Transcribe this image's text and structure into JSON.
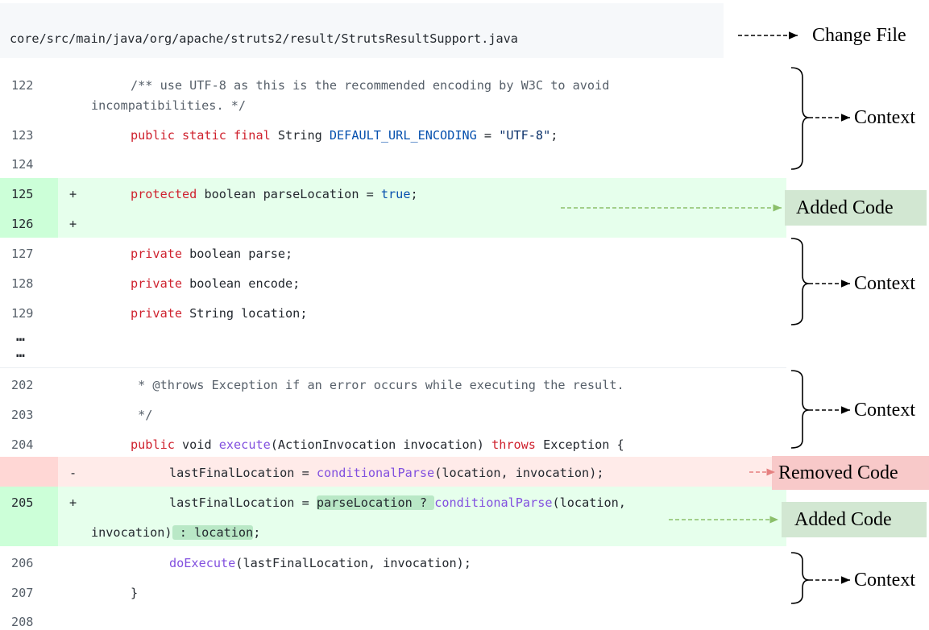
{
  "file": {
    "path": "core/src/main/java/org/apache/struts2/result/StrutsResultSupport.java"
  },
  "annotations": {
    "change_file": "Change File",
    "context": "Context",
    "added_code": "Added Code",
    "removed_code": "Removed Code"
  },
  "ellipsis": "…",
  "lines": {
    "l122": {
      "num": "122",
      "code1": "/** use UTF-8 as this is the recommended encoding by W3C to avoid",
      "code2": "incompatibilities. */"
    },
    "l123": {
      "num": "123",
      "kw": "public static final",
      "t1": " String ",
      "const": "DEFAULT_URL_ENCODING",
      "t2": " = ",
      "str": "\"UTF-8\"",
      "t3": ";"
    },
    "l124": {
      "num": "124"
    },
    "l125": {
      "num": "125",
      "sign": "+",
      "kw": "protected",
      "t1": " boolean parseLocation = ",
      "const": "true",
      "t2": ";"
    },
    "l126": {
      "num": "126",
      "sign": "+"
    },
    "l127": {
      "num": "127",
      "kw": "private",
      "t1": " boolean parse;"
    },
    "l128": {
      "num": "128",
      "kw": "private",
      "t1": " boolean encode;"
    },
    "l129": {
      "num": "129",
      "kw": "private",
      "t1": " String location;"
    },
    "l202": {
      "num": "202",
      "code": " * @throws Exception if an error occurs while executing the result."
    },
    "l203": {
      "num": "203",
      "code": " */"
    },
    "l204": {
      "num": "204",
      "kw1": "public",
      "t1": " void ",
      "fn": "execute",
      "t2": "(ActionInvocation invocation) ",
      "kw2": "throws",
      "t3": " Exception {"
    },
    "removed": {
      "sign": "-",
      "t1": "lastFinalLocation = ",
      "fn": "conditionalParse",
      "t2": "(location, invocation);"
    },
    "l205": {
      "num": "205",
      "sign": "+",
      "t1": "lastFinalLocation = ",
      "hl1": "parseLocation ? ",
      "fn": "conditionalParse",
      "t2": "(location,",
      "t3": "invocation)",
      "hl2": " : location",
      "t4": ";"
    },
    "l206": {
      "num": "206",
      "fn": "doExecute",
      "t1": "(lastFinalLocation, invocation);"
    },
    "l207": {
      "num": "207",
      "code": "}"
    },
    "l208": {
      "num": "208"
    }
  }
}
